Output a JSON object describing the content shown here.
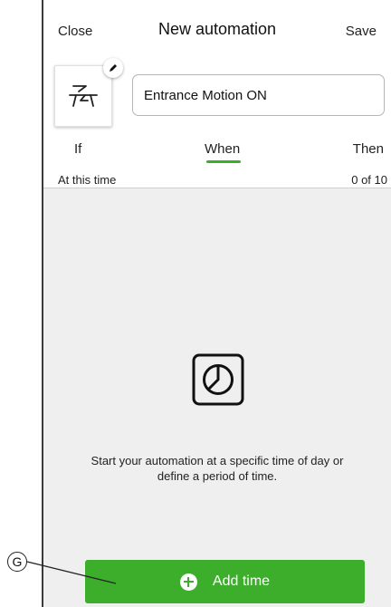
{
  "header": {
    "close_label": "Close",
    "title": "New automation",
    "save_label": "Save"
  },
  "automation": {
    "icon": "scene-icon",
    "edit_icon": "pencil-icon",
    "name_value": "Entrance Motion ON"
  },
  "tabs": [
    {
      "label": "If"
    },
    {
      "label": "When",
      "active": true
    },
    {
      "label": "Then"
    }
  ],
  "section": {
    "label": "At this time",
    "count": "0 of 10"
  },
  "empty_state": {
    "icon": "clock-icon",
    "message": "Start your automation at a specific time of day or define a period of time."
  },
  "add_button": {
    "icon": "plus-circle-icon",
    "label": "Add time"
  },
  "callout": {
    "letter": "G"
  },
  "colors": {
    "accent": "#3dae2b",
    "content_background": "#efefef"
  }
}
